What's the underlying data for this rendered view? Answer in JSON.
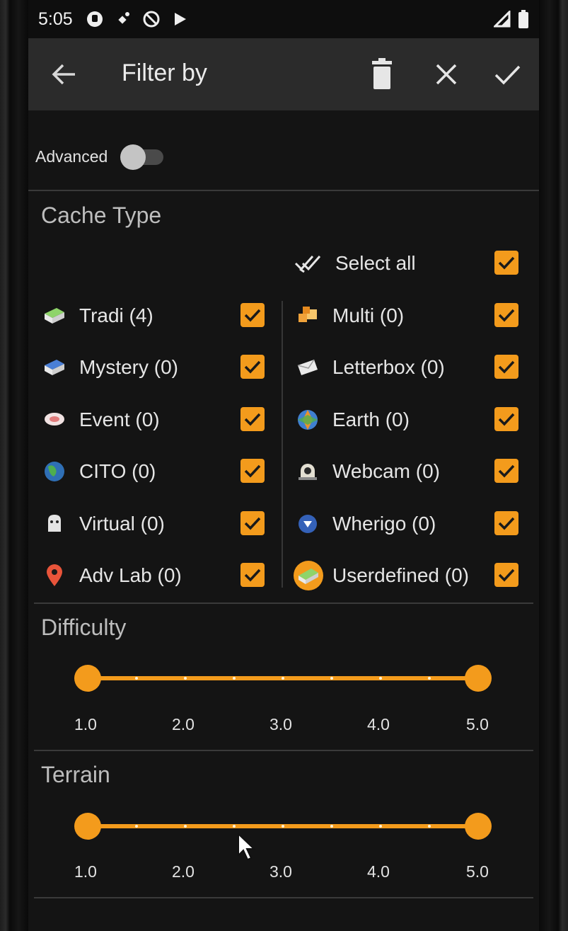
{
  "status_bar": {
    "time": "5:05"
  },
  "app_bar": {
    "title": "Filter by"
  },
  "advanced": {
    "label": "Advanced",
    "enabled": false
  },
  "cache_type": {
    "title": "Cache Type",
    "select_all": {
      "label": "Select all",
      "checked": true
    },
    "left_items": [
      {
        "label": "Tradi (4)",
        "icon": "tradi-icon",
        "checked": true
      },
      {
        "label": "Mystery (0)",
        "icon": "mystery-icon",
        "checked": true
      },
      {
        "label": "Event (0)",
        "icon": "event-icon",
        "checked": true
      },
      {
        "label": "CITO (0)",
        "icon": "cito-icon",
        "checked": true
      },
      {
        "label": "Virtual (0)",
        "icon": "virtual-icon",
        "checked": true
      },
      {
        "label": "Adv Lab (0)",
        "icon": "adv-lab-icon",
        "checked": true
      }
    ],
    "right_items": [
      {
        "label": "Multi (0)",
        "icon": "multi-icon",
        "checked": true
      },
      {
        "label": "Letterbox (0)",
        "icon": "letterbox-icon",
        "checked": true
      },
      {
        "label": "Earth (0)",
        "icon": "earth-icon",
        "checked": true
      },
      {
        "label": "Webcam (0)",
        "icon": "webcam-icon",
        "checked": true
      },
      {
        "label": "Wherigo (0)",
        "icon": "wherigo-icon",
        "checked": true
      },
      {
        "label": "Userdefined (0)",
        "icon": "userdefined-icon",
        "checked": true
      }
    ]
  },
  "difficulty": {
    "title": "Difficulty",
    "range": [
      1.0,
      5.0
    ],
    "selected_min": 1.0,
    "selected_max": 5.0,
    "ticks": [
      "1.0",
      "2.0",
      "3.0",
      "4.0",
      "5.0"
    ]
  },
  "terrain": {
    "title": "Terrain",
    "range": [
      1.0,
      5.0
    ],
    "selected_min": 1.0,
    "selected_max": 5.0,
    "ticks": [
      "1.0",
      "2.0",
      "3.0",
      "4.0",
      "5.0"
    ]
  },
  "colors": {
    "accent": "#f39b1c",
    "background": "#141414",
    "appbar": "#2b2b2b"
  }
}
